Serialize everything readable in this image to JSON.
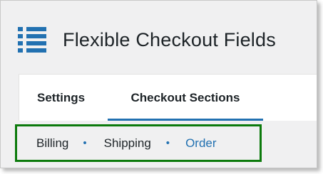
{
  "app": {
    "title": "Flexible Checkout Fields",
    "menu_icon": "list-menu-icon",
    "accent_color": "#2271b1",
    "highlight_color": "#0c7a0c"
  },
  "tabs": [
    {
      "label": "Settings",
      "active": false
    },
    {
      "label": "Checkout Sections",
      "active": true
    }
  ],
  "subnav": {
    "items": [
      {
        "label": "Billing",
        "active": false
      },
      {
        "label": "Shipping",
        "active": false
      },
      {
        "label": "Order",
        "active": true
      }
    ],
    "separator": "•"
  }
}
